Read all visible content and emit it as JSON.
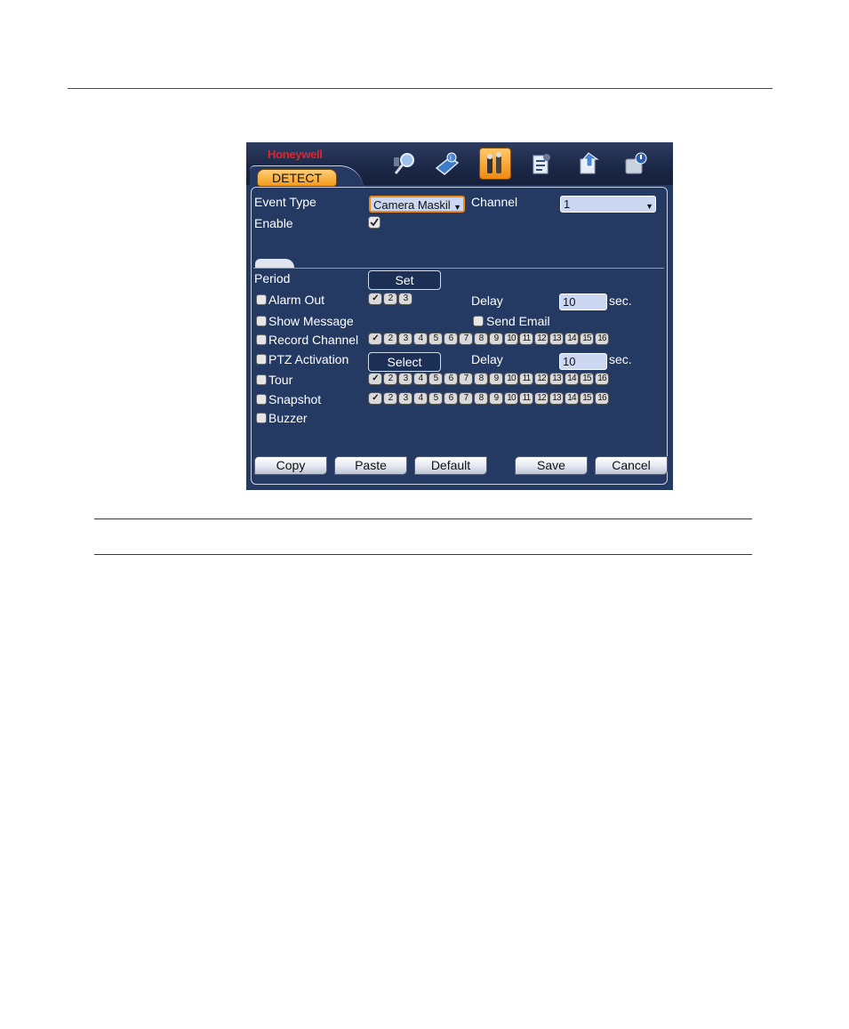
{
  "app": {
    "logo": "Honeywell",
    "active_tab": "DETECT",
    "toolbar_icons": [
      "search-icon",
      "info-icon",
      "settings-icon",
      "advanced-icon",
      "backup-icon",
      "shutdown-icon"
    ],
    "active_toolbar_icon": "settings-icon"
  },
  "form": {
    "event_type_label": "Event Type",
    "event_type_value": "Camera Maskil",
    "channel_label": "Channel",
    "channel_value": "1",
    "enable_label": "Enable",
    "enable_checked": true,
    "period_label": "Period",
    "set_button": "Set",
    "alarm_out_label": "Alarm Out",
    "alarm_out_checked": false,
    "alarm_out_channels": [
      "1",
      "2",
      "3"
    ],
    "delay_label": "Delay",
    "delay_1_value": "10",
    "sec_label": "sec.",
    "show_message_label": "Show Message",
    "show_message_checked": false,
    "send_email_label": "Send Email",
    "send_email_checked": false,
    "record_channel_label": "Record Channel",
    "record_channel_checked": false,
    "ptz_activation_label": "PTZ Activation",
    "ptz_activation_checked": false,
    "select_button": "Select",
    "delay_2_value": "10",
    "tour_label": "Tour",
    "tour_checked": false,
    "snapshot_label": "Snapshot",
    "snapshot_checked": false,
    "buzzer_label": "Buzzer",
    "buzzer_checked": false,
    "channel_numbers": [
      "1",
      "2",
      "3",
      "4",
      "5",
      "6",
      "7",
      "8",
      "9",
      "10",
      "11",
      "12",
      "13",
      "14",
      "15",
      "16"
    ],
    "selected_channel": "1"
  },
  "footer": {
    "copy": "Copy",
    "paste": "Paste",
    "default": "Default",
    "save": "Save",
    "cancel": "Cancel"
  },
  "colors": {
    "panel_bg": "#243a63",
    "accent_orange": "#f59a1b",
    "header_rule": "#c8102e",
    "section_rule": "#27348b"
  }
}
